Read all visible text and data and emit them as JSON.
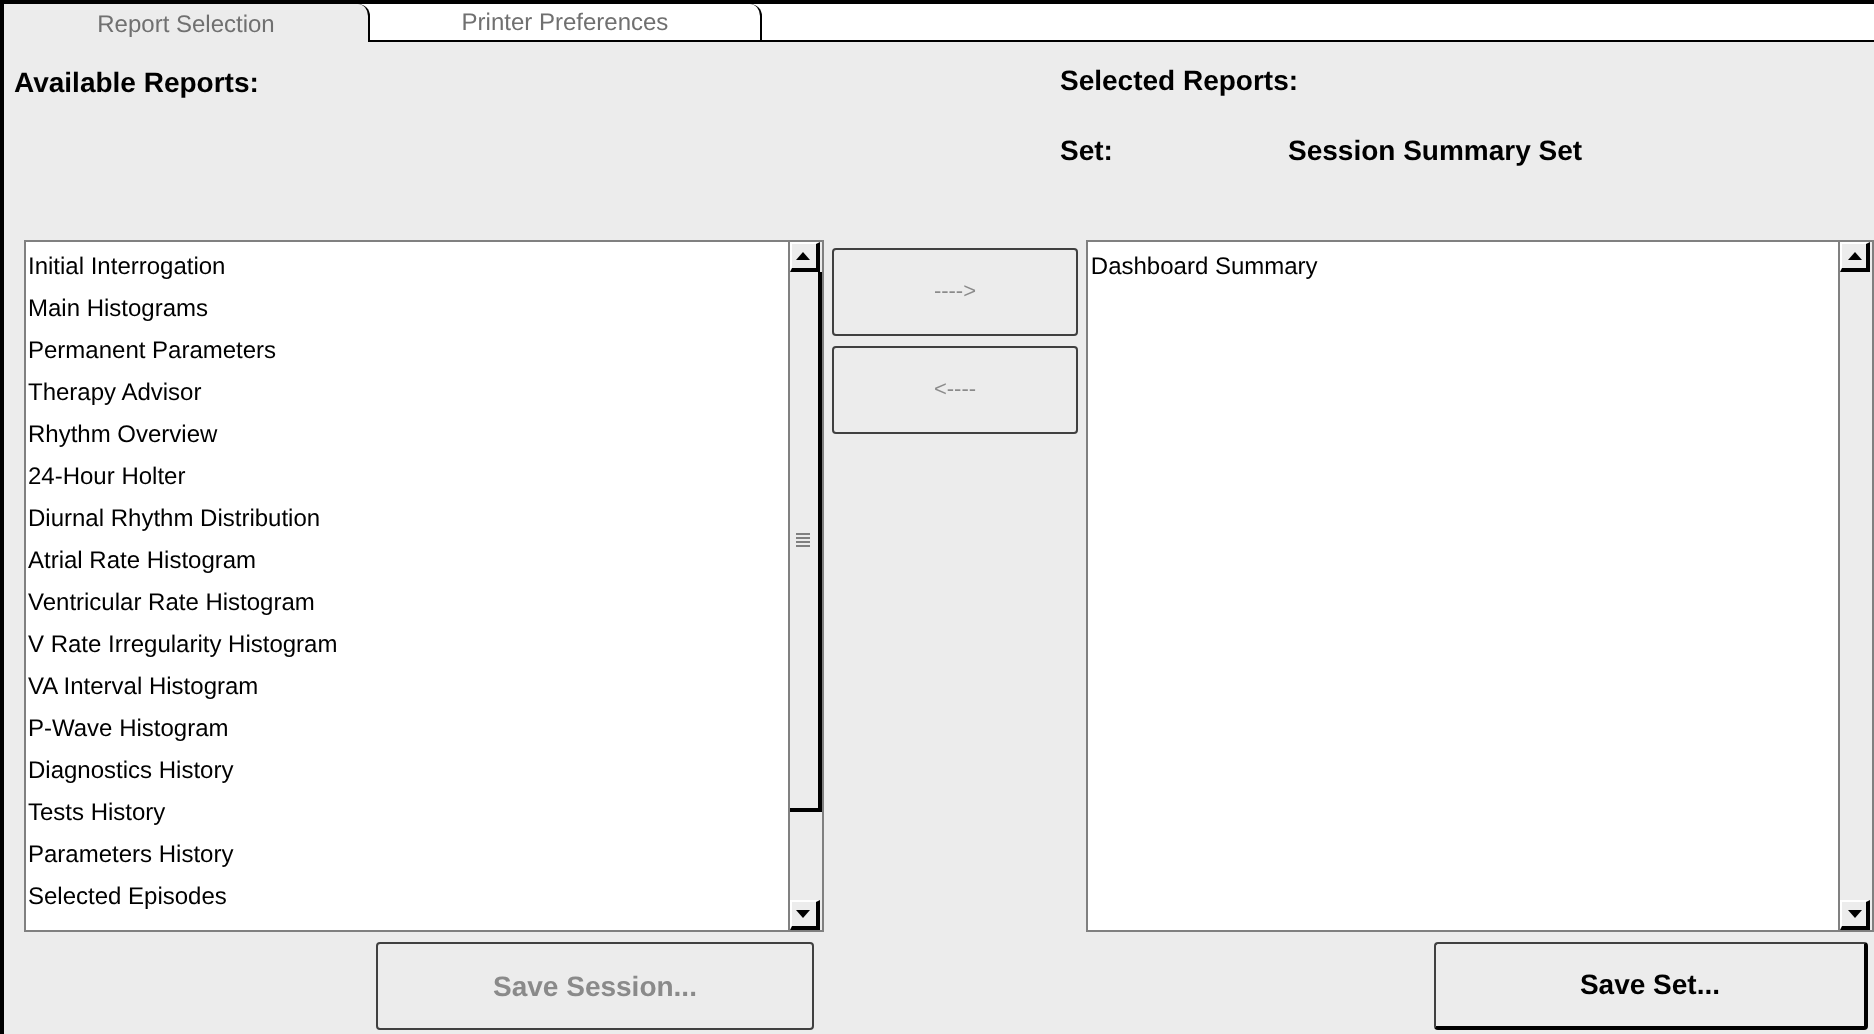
{
  "tabs": [
    {
      "label": "Report Selection",
      "selected": true
    },
    {
      "label": "Printer Preferences",
      "selected": false
    }
  ],
  "available": {
    "heading": "Available Reports:",
    "items": [
      "Initial Interrogation",
      "Main Histograms",
      "Permanent Parameters",
      "Therapy Advisor",
      "Rhythm Overview",
      "24-Hour Holter",
      "Diurnal Rhythm Distribution",
      "Atrial Rate Histogram",
      "Ventricular Rate Histogram",
      "V Rate Irregularity Histogram",
      "VA Interval Histogram",
      "P-Wave Histogram",
      "Diagnostics History",
      "Tests History",
      "Parameters History",
      "Selected Episodes"
    ]
  },
  "move_buttons": [
    {
      "label": "---->",
      "disabled": true
    },
    {
      "label": "<----",
      "disabled": true
    }
  ],
  "selected": {
    "heading": "Selected Reports:",
    "set_label": "Set:",
    "set_name": "Session Summary Set",
    "items": [
      "Dashboard Summary"
    ]
  },
  "buttons": [
    {
      "label": "Save Session...",
      "disabled": true
    },
    {
      "label": "Save Set...",
      "disabled": false
    }
  ]
}
